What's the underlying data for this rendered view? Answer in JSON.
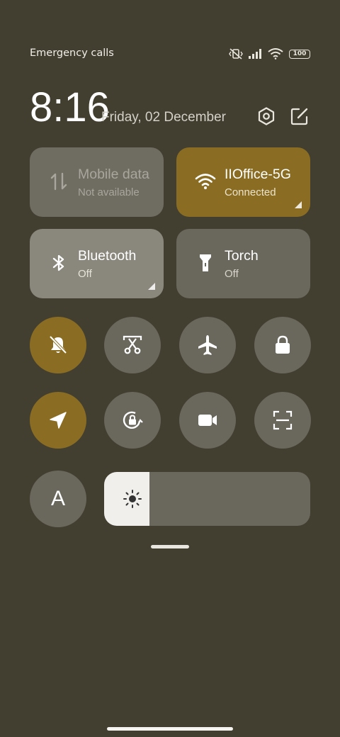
{
  "status_bar": {
    "carrier_text": "Emergency calls o",
    "battery_level": "100",
    "icons": [
      "mute-vibrate-icon",
      "signal-icon",
      "wifi-icon",
      "battery-icon"
    ]
  },
  "header": {
    "time": "8:16",
    "date": "Friday, 02 December"
  },
  "tiles": {
    "mobile_data": {
      "title": "Mobile data",
      "subtitle": "Not available",
      "active": false
    },
    "wifi": {
      "title": "IIOffice-5G",
      "subtitle": "Connected",
      "active": true
    },
    "bluetooth": {
      "title": "Bluetooth",
      "subtitle": "Off",
      "active": false
    },
    "torch": {
      "title": "Torch",
      "subtitle": "Off",
      "active": false
    }
  },
  "toggles": [
    {
      "name": "silent",
      "icon": "bell-off-icon",
      "active": true
    },
    {
      "name": "screenshot",
      "icon": "scissors-icon",
      "active": false
    },
    {
      "name": "airplane-mode",
      "icon": "airplane-icon",
      "active": false
    },
    {
      "name": "lock-screen",
      "icon": "lock-icon",
      "active": false
    },
    {
      "name": "location",
      "icon": "location-arrow-icon",
      "active": true
    },
    {
      "name": "rotation-lock",
      "icon": "rotation-lock-icon",
      "active": false
    },
    {
      "name": "screen-recorder",
      "icon": "video-camera-icon",
      "active": false
    },
    {
      "name": "scanner",
      "icon": "scan-icon",
      "active": false
    }
  ],
  "brightness": {
    "auto_label": "A",
    "level": 0.22
  },
  "colors": {
    "background": "#423e30",
    "accent": "#8a6d22",
    "tile_inactive": "#6a675d"
  }
}
